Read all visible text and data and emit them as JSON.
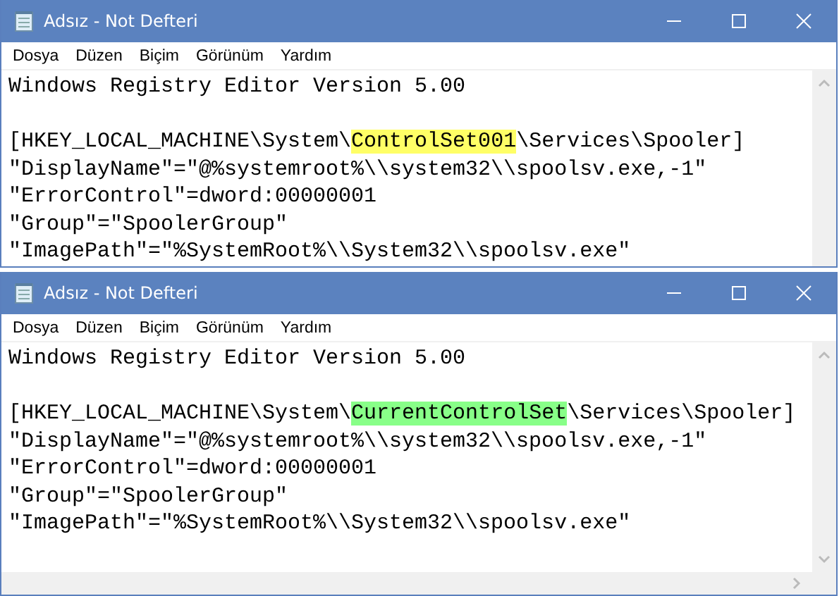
{
  "windows": [
    {
      "title": "Adsız - Not Defteri",
      "menu": [
        "Dosya",
        "Düzen",
        "Biçim",
        "Görünüm",
        "Yardım"
      ],
      "horizontal_scrollbar": false,
      "lines": [
        {
          "kind": "text",
          "segments": [
            {
              "text": "Windows Registry Editor Version 5.00"
            }
          ]
        },
        {
          "kind": "blank"
        },
        {
          "kind": "text",
          "segments": [
            {
              "text": "[HKEY_LOCAL_MACHINE\\System\\"
            },
            {
              "text": "ControlSet001",
              "color": "#ffff66"
            },
            {
              "text": "\\Services\\Spooler]"
            }
          ]
        },
        {
          "kind": "text",
          "segments": [
            {
              "text": "\"DisplayName\"=\"@%systemroot%\\\\system32\\\\spoolsv.exe,-1\""
            }
          ]
        },
        {
          "kind": "text",
          "segments": [
            {
              "text": "\"ErrorControl\"=dword:00000001"
            }
          ]
        },
        {
          "kind": "text",
          "segments": [
            {
              "text": "\"Group\"=\"SpoolerGroup\""
            }
          ]
        },
        {
          "kind": "text",
          "segments": [
            {
              "text": "\"ImagePath\"=\"%SystemRoot%\\\\System32\\\\spoolsv.exe\""
            }
          ]
        }
      ]
    },
    {
      "title": "Adsız - Not Defteri",
      "menu": [
        "Dosya",
        "Düzen",
        "Biçim",
        "Görünüm",
        "Yardım"
      ],
      "horizontal_scrollbar": true,
      "lines": [
        {
          "kind": "text",
          "segments": [
            {
              "text": "Windows Registry Editor Version 5.00"
            }
          ]
        },
        {
          "kind": "blank"
        },
        {
          "kind": "text",
          "segments": [
            {
              "text": "[HKEY_LOCAL_MACHINE\\System\\"
            },
            {
              "text": "CurrentControlSet",
              "color": "#88ff88"
            },
            {
              "text": "\\Services\\Spooler]"
            }
          ]
        },
        {
          "kind": "text",
          "segments": [
            {
              "text": "\"DisplayName\"=\"@%systemroot%\\\\system32\\\\spoolsv.exe,-1\""
            }
          ]
        },
        {
          "kind": "text",
          "segments": [
            {
              "text": "\"ErrorControl\"=dword:00000001"
            }
          ]
        },
        {
          "kind": "text",
          "segments": [
            {
              "text": "\"Group\"=\"SpoolerGroup\""
            }
          ]
        },
        {
          "kind": "text",
          "segments": [
            {
              "text": "\"ImagePath\"=\"%SystemRoot%\\\\System32\\\\spoolsv.exe\""
            }
          ]
        }
      ]
    }
  ]
}
